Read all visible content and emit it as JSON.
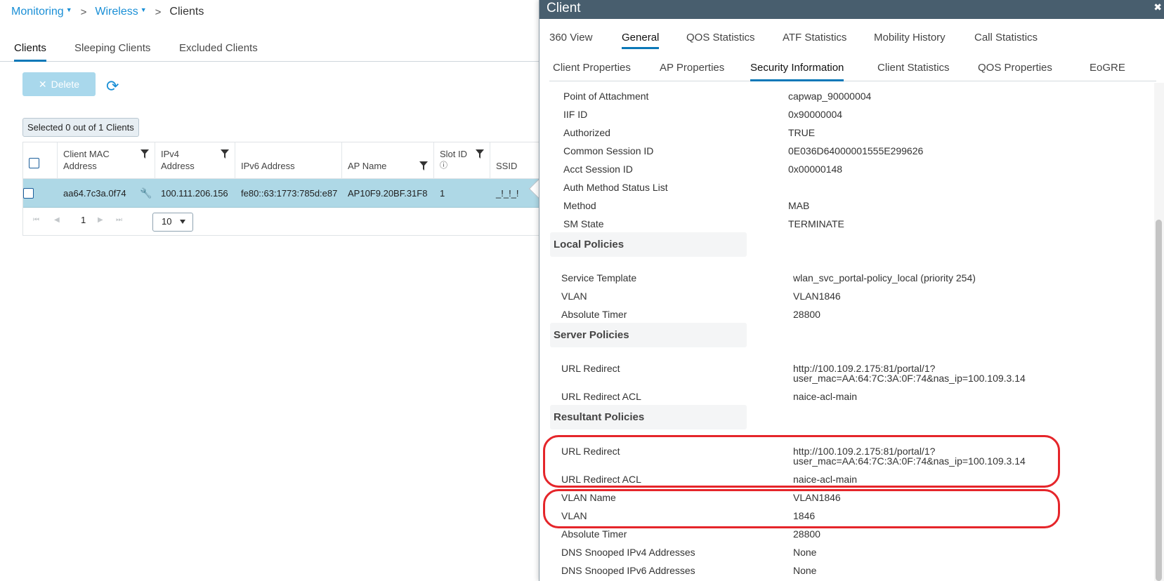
{
  "breadcrumb": {
    "monitoring": "Monitoring",
    "wireless": "Wireless",
    "current": "Clients",
    "separator": ">"
  },
  "main_tabs": [
    "Clients",
    "Sleeping Clients",
    "Excluded Clients"
  ],
  "toolbar": {
    "delete_label": "Delete"
  },
  "selection": {
    "text": "Selected 0 out of 1 Clients"
  },
  "grid": {
    "headers": {
      "mac": [
        "Client MAC",
        "Address"
      ],
      "ipv4": [
        "IPv4",
        "Address"
      ],
      "ipv6": "IPv6 Address",
      "ap_name": "AP Name",
      "slot": "Slot ID",
      "ssid": "SSID"
    },
    "row": {
      "mac": "aa64.7c3a.0f74",
      "ipv4": "100.111.206.156",
      "ipv6": "fe80::63:1773:785d:e87",
      "ap_name": "AP10F9.20BF.31F8",
      "slot": "1",
      "ssid": "_!_!_!"
    },
    "pager": {
      "page": "1",
      "page_size": "10"
    }
  },
  "drawer": {
    "title": "Client",
    "tabs": [
      "360 View",
      "General",
      "QOS Statistics",
      "ATF Statistics",
      "Mobility History",
      "Call Statistics"
    ],
    "subtabs": [
      "Client Properties",
      "AP Properties",
      "Security Information",
      "Client Statistics",
      "QOS Properties",
      "EoGRE"
    ],
    "security": [
      {
        "label": "Point of Attachment",
        "value": "capwap_90000004"
      },
      {
        "label": "IIF ID",
        "value": "0x90000004"
      },
      {
        "label": "Authorized",
        "value": "TRUE"
      },
      {
        "label": "Common Session ID",
        "value": "0E036D64000001555E299626"
      },
      {
        "label": "Acct Session ID",
        "value": "0x00000148"
      },
      {
        "label": "Auth Method Status List",
        "value": ""
      },
      {
        "label": "Method",
        "value": "MAB"
      },
      {
        "label": "SM State",
        "value": "TERMINATE"
      }
    ],
    "local_policies": {
      "title": "Local Policies",
      "rows": [
        {
          "label": "Service Template",
          "value": "wlan_svc_portal-policy_local (priority 254)"
        },
        {
          "label": "VLAN",
          "value": "VLAN1846"
        },
        {
          "label": "Absolute Timer",
          "value": "28800"
        }
      ]
    },
    "server_policies": {
      "title": "Server Policies",
      "url_redirect_label": "URL Redirect",
      "url_redirect_value": [
        "http://100.109.2.175:81/portal/1?",
        "user_mac=AA:64:7C:3A:0F:74&nas_ip=100.109.3.14"
      ],
      "acl_label": "URL Redirect ACL",
      "acl_value": "naice-acl-main"
    },
    "resultant_policies": {
      "title": "Resultant Policies",
      "url_redirect_label": "URL Redirect",
      "url_redirect_value": [
        "http://100.109.2.175:81/portal/1?",
        "user_mac=AA:64:7C:3A:0F:74&nas_ip=100.109.3.14"
      ],
      "acl_label": "URL Redirect ACL",
      "acl_value": "naice-acl-main",
      "vlan_name_label": "VLAN Name",
      "vlan_name_value": "VLAN1846",
      "vlan_label": "VLAN",
      "vlan_value": "1846",
      "timer_label": "Absolute Timer",
      "timer_value": "28800",
      "dns4_label": "DNS Snooped IPv4 Addresses",
      "dns4_value": "None",
      "dns6_label": "DNS Snooped IPv6 Addresses",
      "dns6_value": "None"
    }
  },
  "colors": {
    "accent": "#0a78b8",
    "link": "#1a8fd6",
    "header": "#485e6e",
    "selected_row": "#aed8e6",
    "highlight": "#e5252a"
  }
}
